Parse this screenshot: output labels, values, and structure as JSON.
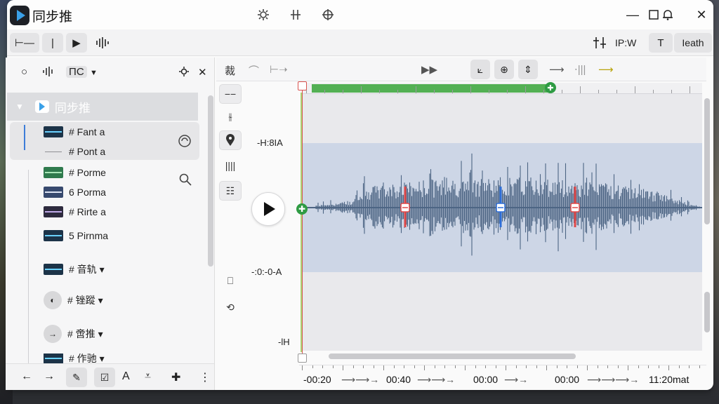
{
  "app": {
    "title": "同步推"
  },
  "titlebar": {
    "center_icons": [
      "settings-gear-icon",
      "split-icon",
      "crosshair-icon"
    ],
    "controls": [
      "minimize",
      "restore",
      "notifications",
      "close"
    ]
  },
  "toolbar": {
    "right_label_1": "IP:W",
    "right_label_2": "T",
    "right_label_3": "Ieath"
  },
  "left_panel": {
    "group_name": "同步推",
    "rows": [
      {
        "label": "# Fant a",
        "thumb_color": "#1c3348"
      },
      {
        "label": "# Pont a",
        "thumb_color": "#8f8f94"
      },
      {
        "label": "# Porme",
        "thumb_color": "#2f7a4d"
      },
      {
        "label": "6 Porma",
        "thumb_color": "#37496e"
      },
      {
        "label": "# Rirte a",
        "thumb_color": "#2d2a3e"
      },
      {
        "label": "5 Pirnma",
        "thumb_color": "#1c3348"
      },
      {
        "label": "# 音轨 ▾",
        "thumb_color": "#1c3348"
      },
      {
        "label": "# 锉蹤 ▾",
        "thumb_color": "round"
      },
      {
        "label": "# 啻推 ▾",
        "thumb_color": "round"
      },
      {
        "label": "# 作驰 ▾",
        "thumb_color": "#1c3348"
      }
    ]
  },
  "editor": {
    "toolbar_char": "裁",
    "y_labels": [
      "-H:8IA",
      "-:0:-0-A",
      "-lH"
    ],
    "timeline": [
      "-00:20",
      "00:40",
      "00:00",
      "00:00",
      "11:20mat"
    ]
  },
  "colors": {
    "accent": "#3aa0e8",
    "waveform": "#4d6584",
    "selection": "#cdd6e6",
    "overview_green": "#53b054",
    "playhead": "#d9534f",
    "marker_red": "#e04848",
    "marker_blue": "#2f6fd8"
  }
}
